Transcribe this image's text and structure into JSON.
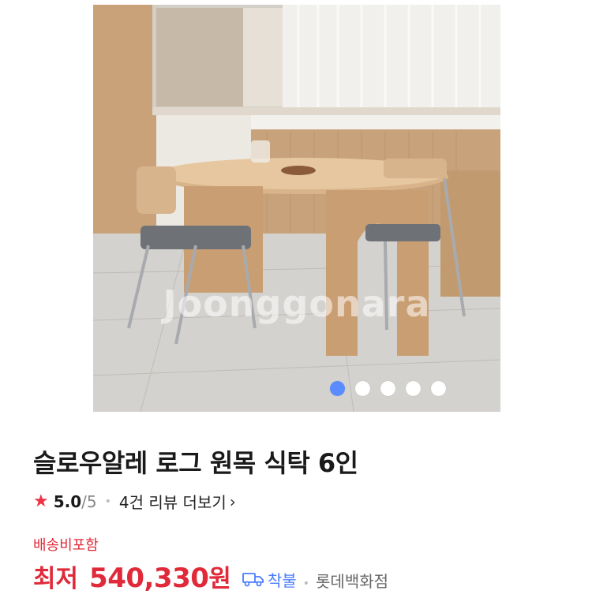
{
  "product": {
    "title": "슬로우알레 로그 원목 식탁 6인",
    "rating": {
      "score": "5.0",
      "max": "/5",
      "reviews_label": "4건 리뷰 더보기",
      "chevron": "›"
    },
    "shipping_label": "배송비포함",
    "price": {
      "prefix": "최저",
      "amount": "540,330",
      "unit": "원"
    },
    "delivery_label": "착불",
    "seller": "롯데백화점"
  },
  "gallery": {
    "watermark": "Joonggonara",
    "slide_count": 5,
    "active_slide": 1
  },
  "colors": {
    "accent_red": "#e02a3a",
    "accent_blue": "#4a7cff",
    "active_dot": "#5a8cff"
  }
}
